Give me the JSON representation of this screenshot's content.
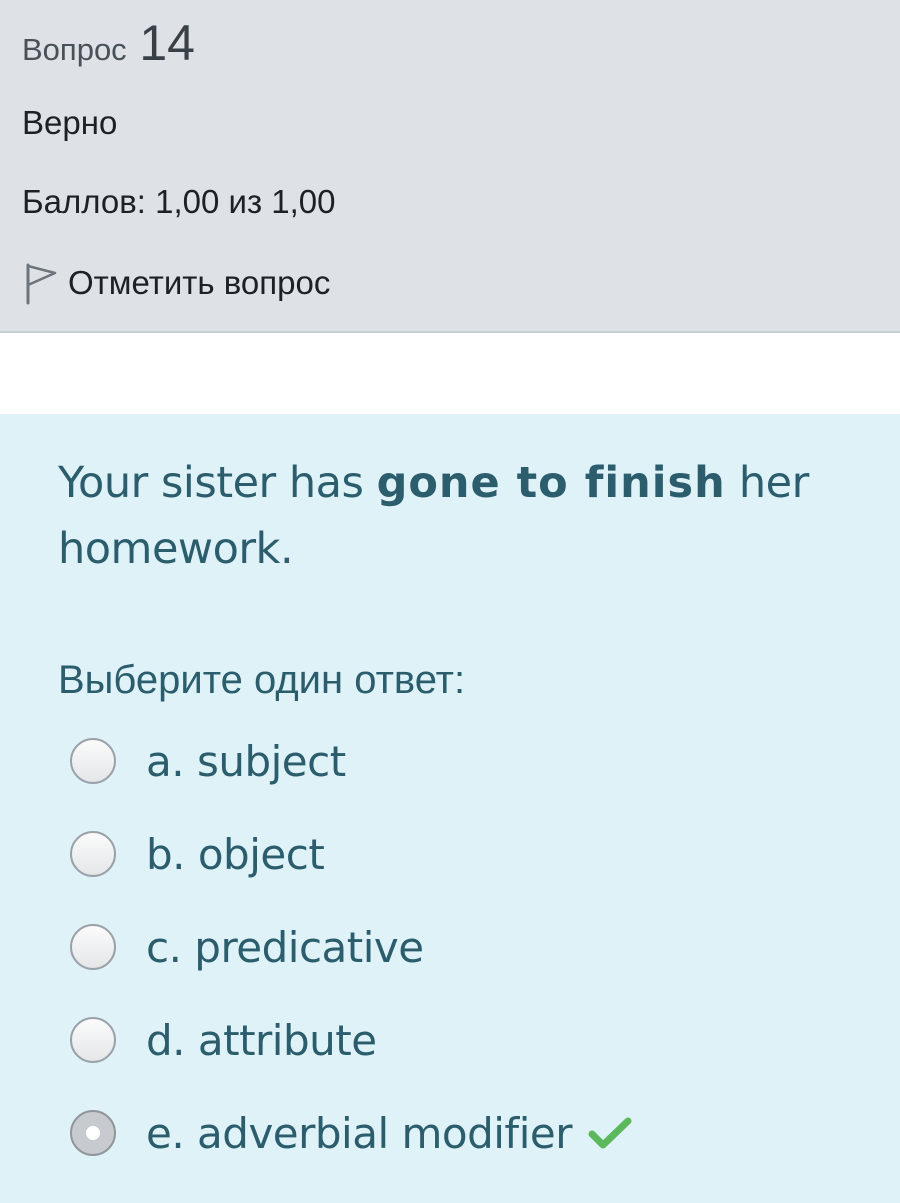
{
  "question_info": {
    "number_prefix": "Вопрос",
    "number": "14",
    "state": "Верно",
    "grade": "Баллов: 1,00 из 1,00",
    "flag_label": "Отметить вопрос",
    "flag_icon": "flag-outline-icon"
  },
  "question": {
    "text_before": "Your sister has ",
    "text_emphasis": "gone to finish",
    "text_after": " her homework.",
    "prompt": "Выберите один ответ:"
  },
  "answers": [
    {
      "label": "a. subject",
      "selected": false,
      "correct": false
    },
    {
      "label": "b. object",
      "selected": false,
      "correct": false
    },
    {
      "label": "c. predicative",
      "selected": false,
      "correct": false
    },
    {
      "label": "d. attribute",
      "selected": false,
      "correct": false
    },
    {
      "label": "e. adverbial modifier",
      "selected": true,
      "correct": true
    }
  ],
  "colors": {
    "info_background": "#dee2e6",
    "content_background": "#def2f8",
    "text_teal": "#2b5d6c",
    "correct_check": "#5cb85c"
  },
  "icons": {
    "correct": "check-icon",
    "radio": "radio-icon"
  }
}
